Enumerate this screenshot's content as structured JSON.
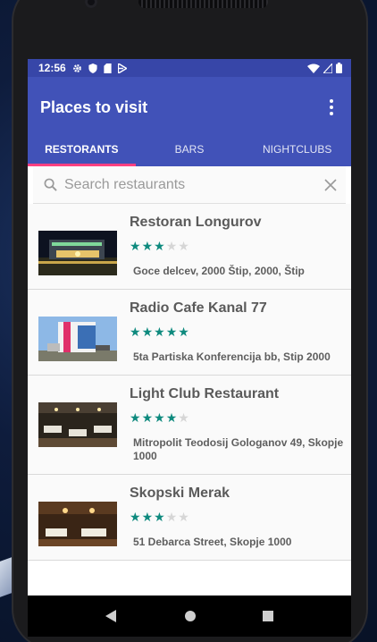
{
  "status": {
    "time": "12:56",
    "left_icons": [
      "gear-icon",
      "shield-icon",
      "sd-card-icon",
      "play-store-icon"
    ],
    "right_icons": [
      "wifi-icon",
      "signal-icon",
      "battery-icon"
    ]
  },
  "appbar": {
    "title": "Places to visit",
    "menu_icon": "overflow-menu-icon"
  },
  "tabs": [
    {
      "label": "Restorants",
      "active": true
    },
    {
      "label": "Bars",
      "active": false
    },
    {
      "label": "Nightclubs",
      "active": false
    }
  ],
  "search": {
    "placeholder": "Search restaurants",
    "value": ""
  },
  "restaurants": [
    {
      "name": "Restoran Longurov",
      "rating": 3,
      "max_rating": 5,
      "address": "Goce delcev, 2000 Štip, 2000, Štip"
    },
    {
      "name": "Radio Cafe Kanal 77",
      "rating": 5,
      "max_rating": 5,
      "address": "5ta Partiska Konferencija bb, Stip 2000"
    },
    {
      "name": "Light Club Restaurant",
      "rating": 4,
      "max_rating": 5,
      "address": "Mitropolit Teodosij Gologanov 49, Skopje 1000"
    },
    {
      "name": "Skopski Merak",
      "rating": 3,
      "max_rating": 5,
      "address": "51 Debarca Street, Skopje 1000"
    }
  ],
  "navbar": {
    "buttons": [
      "back-icon",
      "home-icon",
      "recents-icon"
    ]
  },
  "colors": {
    "primary": "#4152b8",
    "primary_dark": "#3746a8",
    "accent": "#ff4081",
    "star": "#0e8a7e"
  }
}
